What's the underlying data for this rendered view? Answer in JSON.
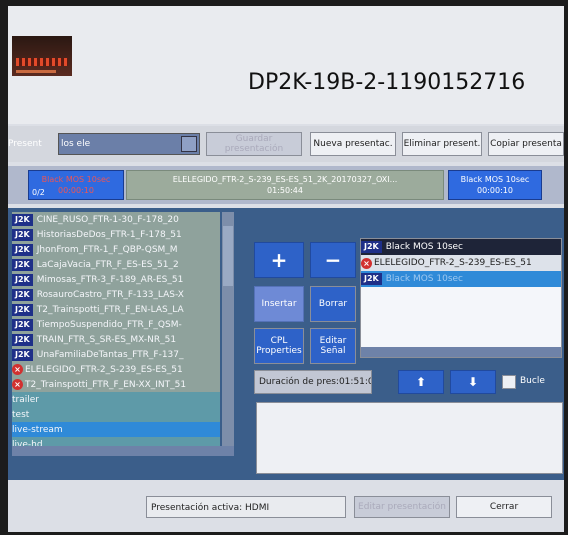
{
  "title": "DP2K-19B-2-1190152716",
  "toolbar": {
    "present_label": "Present",
    "present_value": "los ele",
    "disabled_button": "Guardar presentación",
    "buttons": [
      "Nueva presentac.",
      "Eliminar present.",
      "Copiar presenta"
    ]
  },
  "timeline": {
    "clip1_line1": "Black MOS 10sec",
    "clip1_line2": "00:00:10",
    "clip1_tag": "0/2",
    "clip2_line1": "ELELEGIDO_FTR-2_S-239_ES-ES_51_2K_20170327_OXI...",
    "clip2_line2": "01:50:44",
    "clip3_line1": "Black MOS 10sec",
    "clip3_line2": "00:00:10"
  },
  "left_list": [
    {
      "type": "J2K",
      "text": "CINE_RUSO_FTR-1-30_F-178_20",
      "style": "green"
    },
    {
      "type": "J2K",
      "text": "HistoriasDeDos_FTR-1_F-178_51",
      "style": "green"
    },
    {
      "type": "J2K",
      "text": "JhonFrom_FTR-1_F_QBP-QSM_M",
      "style": "green"
    },
    {
      "type": "J2K",
      "text": "LaCajaVacia_FTR_F_ES-ES_51_2",
      "style": "green"
    },
    {
      "type": "J2K",
      "text": "Mimosas_FTR-3_F-189_AR-ES_51",
      "style": "green"
    },
    {
      "type": "J2K",
      "text": "RosauroCastro_FTR_F-133_LAS-X",
      "style": "green"
    },
    {
      "type": "J2K",
      "text": "T2_Trainspotti_FTR_F_EN-LAS_LA",
      "style": "green"
    },
    {
      "type": "J2K",
      "text": "TiempoSuspendido_FTR_F_QSM-",
      "style": "green"
    },
    {
      "type": "J2K",
      "text": "TRAIN_FTR_S_SR-ES_MX-NR_51",
      "style": "green"
    },
    {
      "type": "J2K",
      "text": "UnaFamiliaDeTantas_FTR_F-137_",
      "style": "green"
    },
    {
      "type": "ERR",
      "text": "ELELEGIDO_FTR-2_S-239_ES-ES_51",
      "style": "green"
    },
    {
      "type": "ERR",
      "text": "T2_Trainspotti_FTR_F_EN-XX_INT_51",
      "style": "green"
    },
    {
      "type": "",
      "text": "trailer",
      "style": "teal"
    },
    {
      "type": "",
      "text": "test",
      "style": "teal"
    },
    {
      "type": "",
      "text": "live-stream",
      "style": "sel"
    },
    {
      "type": "",
      "text": "live-hd",
      "style": "teal"
    }
  ],
  "middle": {
    "add": "+",
    "remove": "−",
    "disabled_btn": "Insertar",
    "borrar": "Borrar",
    "cpl_properties": "CPL Properties",
    "editar_senal": "Editar Señal"
  },
  "right_list": [
    {
      "type": "J2K",
      "text": "Black MOS 10sec",
      "style": "dark"
    },
    {
      "type": "ERR",
      "text": "ELELEGIDO_FTR-2_S-239_ES-ES_51",
      "style": "plain"
    },
    {
      "type": "J2K",
      "text": "Black MOS 10sec",
      "style": "sel"
    }
  ],
  "duration": "Duración de pres:01:51:04",
  "loop_label": "Bucle",
  "bottom": {
    "active": "Presentación activa: HDMI",
    "disabled": "Editar presentación",
    "close": "Cerrar"
  },
  "colors": {
    "accent_blue": "#2e62c8",
    "clip_blue": "#2f6ae0",
    "clip_green": "#9cab9c",
    "panel": "#3b5e8a"
  }
}
